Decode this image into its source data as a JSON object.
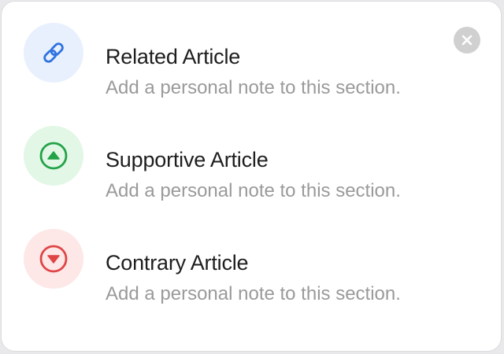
{
  "colors": {
    "related_bg": "#e9f0fd",
    "related_icon": "#2f73e0",
    "supportive_bg": "#e2f7e6",
    "supportive_icon": "#23a247",
    "contrary_bg": "#fde7e7",
    "contrary_icon": "#df4545",
    "close_bg": "#d0d0d0"
  },
  "close": {
    "icon": "close-icon"
  },
  "options": [
    {
      "icon": "link-icon",
      "title": "Related Article",
      "subtitle": "Add a personal note to this section."
    },
    {
      "icon": "triangle-up-circle-icon",
      "title": "Supportive Article",
      "subtitle": "Add a personal note to this section."
    },
    {
      "icon": "triangle-down-circle-icon",
      "title": "Contrary Article",
      "subtitle": "Add a personal note to this section."
    }
  ]
}
